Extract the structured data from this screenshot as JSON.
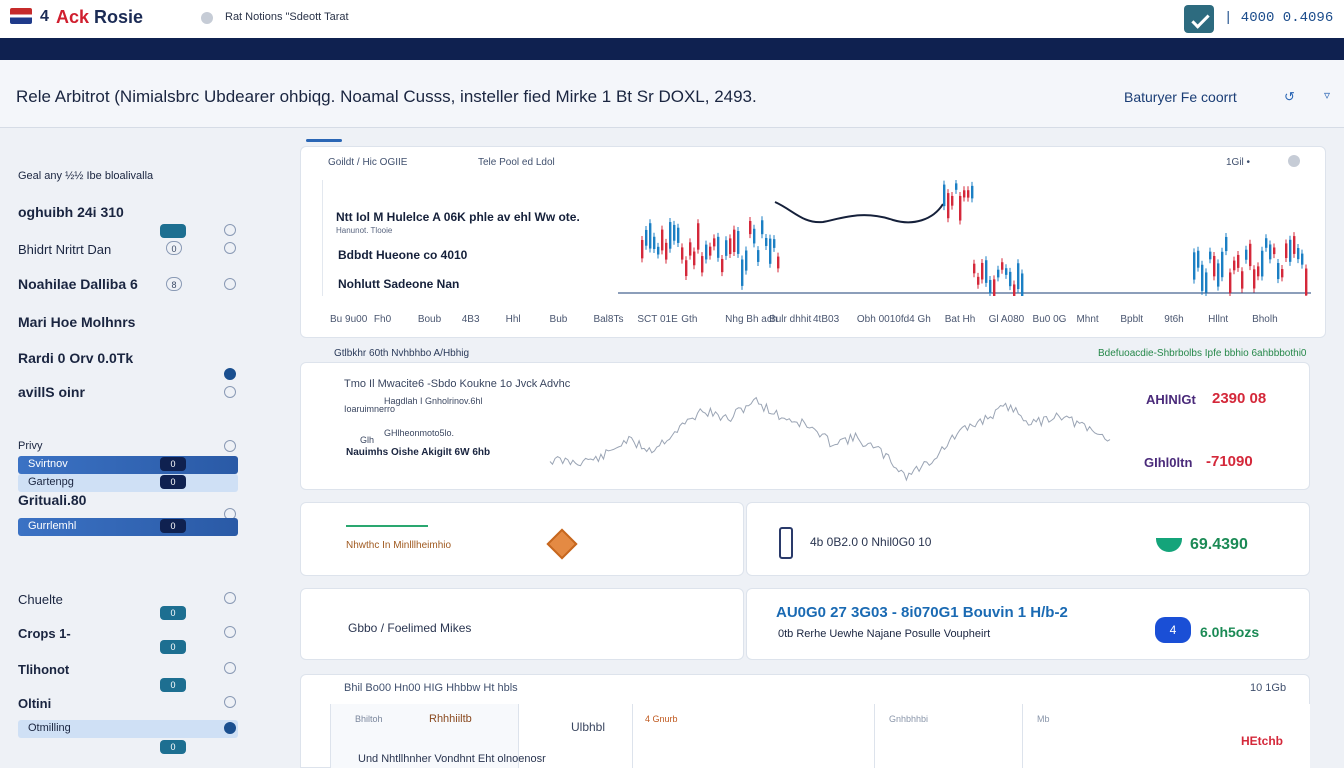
{
  "topbar": {
    "logo_num": "4",
    "logo_text_red": "Ack",
    "logo_text": "Rosie",
    "link_text": "Rat Notions \"Sdeott Tarat",
    "readout": "| 4000 0.4096"
  },
  "headline": {
    "text": "Rele Arbitrot (Nimialsbrc Ubdearer ohbiqg. Noamal Cusss, insteller fied Mirke 1 Bt Sr DOXL, 2493.",
    "right_link": "Baturyer Fe coorrt",
    "icon_a": "↺",
    "icon_b": "▿"
  },
  "sidebar": {
    "rows": [
      {
        "label": "Geal any  ½½ Ibe bloalivalla",
        "style": "small-dark",
        "count": "",
        "ind": ""
      },
      {
        "label": "oghuibh 24i  310",
        "style": "big",
        "count": "",
        "ind": ""
      },
      {
        "label": "Bhidrt Nritrt  Dan",
        "style": "normal",
        "count": "0",
        "ind": "o"
      },
      {
        "label": "Noahilae Dalliba 6",
        "style": "big",
        "count": "8",
        "ind": "o"
      },
      {
        "label": "Mari Hoe Molhnrs",
        "style": "big",
        "count": "",
        "ind": ""
      },
      {
        "label": "Rardi 0 Orv 0.0Tk",
        "style": "big",
        "count": "",
        "ind": ""
      },
      {
        "label": "avillS oinr",
        "style": "big",
        "count": "",
        "ind": "o"
      },
      {
        "label": "Privy",
        "style": "normal",
        "count": "",
        "ind": "o"
      },
      {
        "label": "Svirtnov",
        "style": "sel",
        "count": "0",
        "ind": ""
      },
      {
        "label": "Gartenpg",
        "style": "lite",
        "count": "0",
        "ind": ""
      },
      {
        "label": "Grituali.80",
        "style": "big",
        "count": "",
        "ind": "o"
      },
      {
        "label": "Gurrlemhl",
        "style": "sel",
        "count": "0",
        "ind": ""
      },
      {
        "label": "Chuelte",
        "style": "normal",
        "count": "0",
        "ind": "o"
      },
      {
        "label": "Crops 1-",
        "style": "normal",
        "count": "0",
        "ind": "o"
      },
      {
        "label": "Tlihonot",
        "style": "normal",
        "count": "0",
        "ind": "o"
      },
      {
        "label": "Oltini",
        "style": "normal",
        "count": "0",
        "ind": "o"
      },
      {
        "label": "Otmilling",
        "style": "lite",
        "count": "0",
        "ind": ""
      }
    ]
  },
  "candle_panel": {
    "head_left": "Goildt / Hic  OGIIE",
    "head_mid": "Tele Pool ed Ldol",
    "head_right": "1Gil •",
    "legend_1": "Ntt Iol M Hulelce  A 06K  phle  av  ehl Ww ote.",
    "legend_1_sub": "Hanunot.  Tlooie",
    "legend_2": "Bdbdt Hueone  co  4010",
    "legend_3": "Nohlutt Sadeone Nan",
    "xticks": [
      "Bu 9u00",
      "Fh0",
      "Boub",
      "4B3",
      "Hhl",
      "Bub",
      "Bal8Ts",
      "SCT 01E",
      "Gth",
      "Nhg  Bh  ach",
      "Bulr  dhhit",
      "4tB03",
      "Obh 0010",
      "fd4 Gh",
      "Bat Hh",
      "Gl A080",
      "Bu0 0G",
      "Mhnt",
      "Bpblt",
      "9t6h",
      "Hllnt",
      "Bholh"
    ]
  },
  "captions": {
    "left": "Gtlbkhr 60th Nvhbhbo A/Hbhig",
    "right": "Bdefuoacdie-Shbrbolbs Ipfe bbhio 6ahbbbothi0"
  },
  "line_panel": {
    "label_1": "Tmo  Il  Mwacite6  -Sbdo  Koukne  1o  Jvck  Advhc",
    "label_2": "Hagdlah  I  Gnholrinov.6hl",
    "label_3": "Ioaruimnerro",
    "label_4": "GHlheonmoto5lo.",
    "label_5": "Glh",
    "label_6": "Nauimhs Oishe AkigiIt 6W   6hb",
    "val_1_label": "AHlNlGt",
    "val_1": "2390 08",
    "val_2_label": "GIhl0ltn",
    "val_2": "-71090"
  },
  "card_a": {
    "label": "Nhwthc In   Minlllheimhio"
  },
  "card_b": {
    "label": "4b 0B2.0  0  Nhil0G0  10",
    "value": "69.4390"
  },
  "card_c": {
    "label": "Gbbo / Foelimed  Mikes"
  },
  "card_d": {
    "title": "AU0G0 27 3G03 - 8i070G1 Bouvin 1 H/b-2",
    "subtitle": "0tb  Rerhe  Uewhe  Najane  Posulle  Voupheirt",
    "pill": "4",
    "value": "6.0h5ozs"
  },
  "bottom_panel": {
    "head_left": "Bhil Bo00 Hn00 HIG Hhbbw Ht hbls",
    "head_right": "10  1Gb",
    "cell_1": "Bhiltoh",
    "cell_1b": "Rhhhiiltb",
    "cell_2": "Ulbhbl",
    "cell_3": "4 Gnurb",
    "cell_4": "Gnhbhhbi",
    "cell_5": "Mb",
    "cell_5_val": "HEtchb",
    "footer": "Und Nhtllhnher Vondhnt Eht  olnoenosr"
  },
  "colors": {
    "navy": "#0f2150",
    "accent": "#2a66b5",
    "up": "#1b7fc4",
    "down": "#d4283a"
  }
}
